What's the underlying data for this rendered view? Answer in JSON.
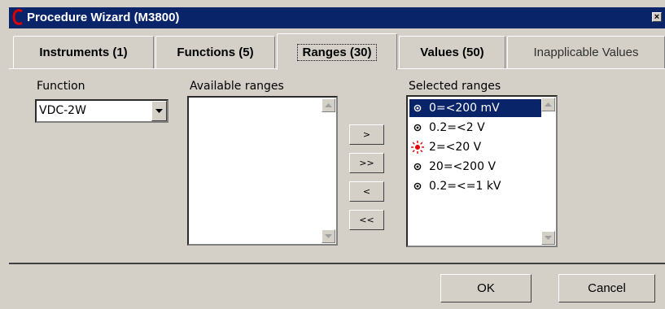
{
  "window": {
    "title": "Procedure Wizard (M3800)",
    "close_glyph": "×"
  },
  "tabs": [
    {
      "label": "Instruments (1)"
    },
    {
      "label": "Functions (5)"
    },
    {
      "label": "Ranges (30)"
    },
    {
      "label": "Values (50)"
    },
    {
      "label": "Inapplicable Values"
    }
  ],
  "active_tab": "Ranges (30)",
  "function": {
    "label": "Function",
    "selected": "VDC-2W"
  },
  "available": {
    "label": "Available ranges",
    "items": []
  },
  "move_buttons": {
    "add": ">",
    "add_all": ">>",
    "remove": "<",
    "remove_all": "<<"
  },
  "selected": {
    "label": "Selected ranges",
    "items": [
      {
        "text": "0=<200 mV",
        "icon": "radio-dot-icon",
        "highlighted": true
      },
      {
        "text": "0.2=<2 V",
        "icon": "radio-dot-icon"
      },
      {
        "text": "2=<20 V",
        "icon": "red-sun-icon"
      },
      {
        "text": "20=<200 V",
        "icon": "radio-dot-icon"
      },
      {
        "text": "0.2=<=1 kV",
        "icon": "radio-dot-icon"
      }
    ]
  },
  "footer": {
    "ok": "OK",
    "cancel": "Cancel"
  },
  "colors": {
    "titlebar": "#0a246a",
    "face": "#d4d0c8",
    "selection": "#0a246a",
    "logo": "#e00000",
    "sun": "#e00000"
  }
}
